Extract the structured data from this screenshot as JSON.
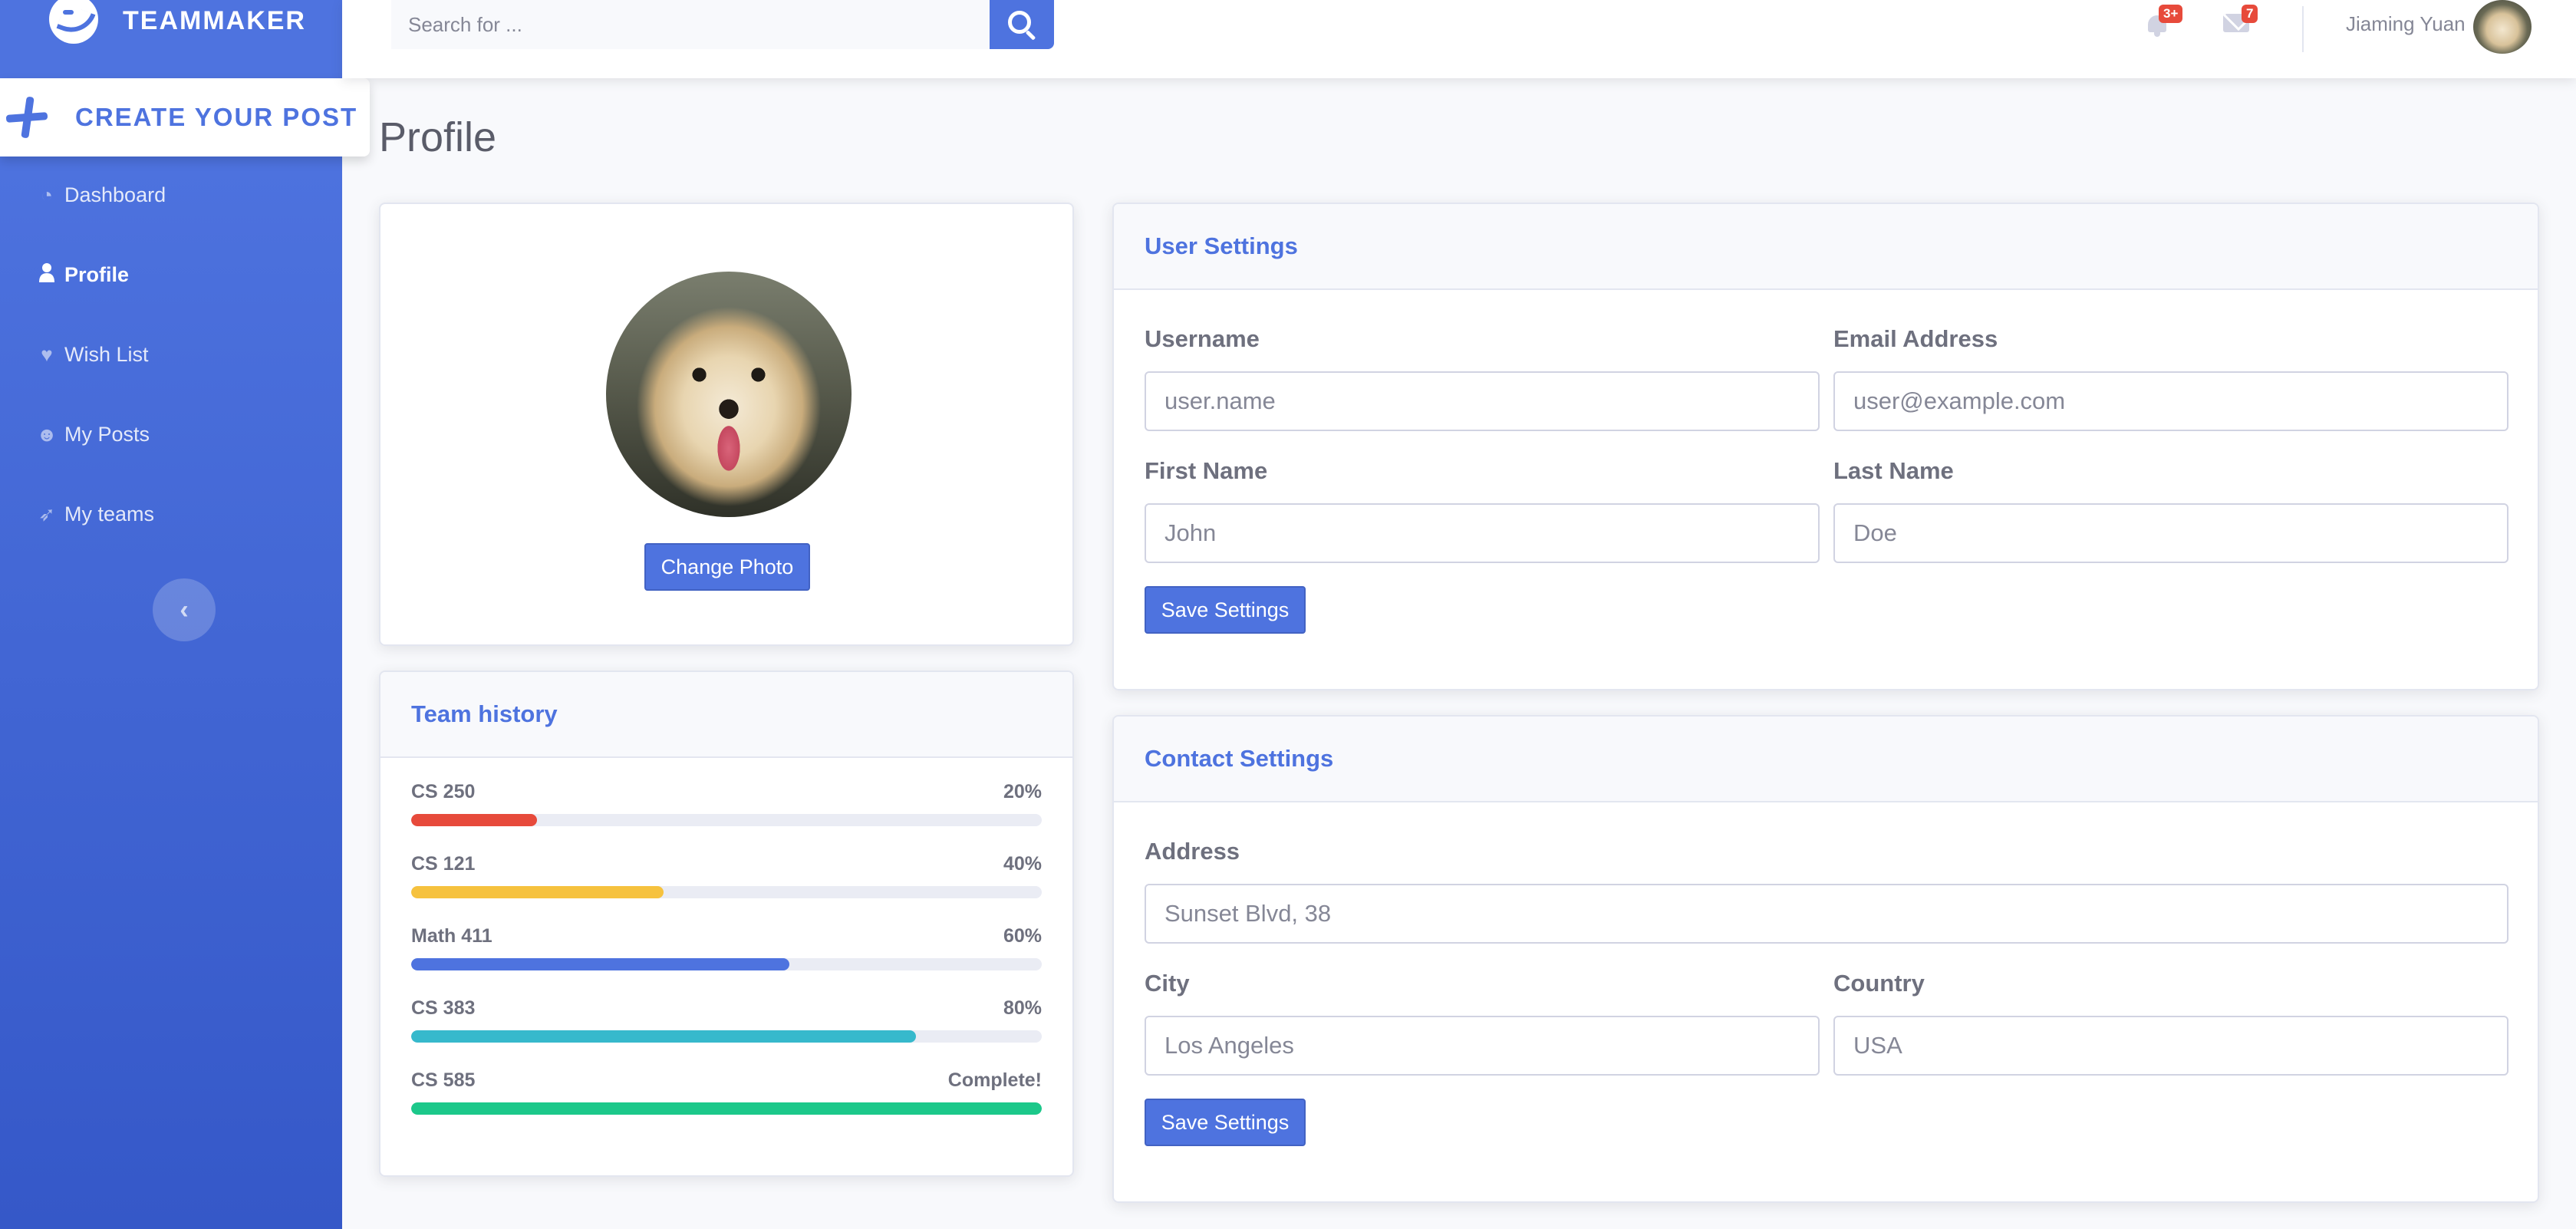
{
  "brand": {
    "name": "TEAMMAKER"
  },
  "sidebar": {
    "create_post": "CREATE YOUR POST",
    "items": [
      {
        "label": "Dashboard",
        "icon": "tachometer-icon",
        "glyph": "◔",
        "active": false
      },
      {
        "label": "Profile",
        "icon": "user-icon",
        "glyph": "👤",
        "active": true
      },
      {
        "label": "Wish List",
        "icon": "heart-icon",
        "glyph": "♥",
        "active": false
      },
      {
        "label": "My Posts",
        "icon": "user-circle-icon",
        "glyph": "☻",
        "active": false
      },
      {
        "label": "My teams",
        "icon": "rocket-icon",
        "glyph": "➶",
        "active": false
      }
    ],
    "toggle_glyph": "‹"
  },
  "topbar": {
    "search_placeholder": "Search for ...",
    "alerts_count": "3+",
    "messages_count": "7",
    "user_name": "Jiaming Yuan"
  },
  "page": {
    "title": "Profile"
  },
  "photo_card": {
    "button_label": "Change Photo"
  },
  "team_history": {
    "title": "Team history",
    "items": [
      {
        "name": "CS 250",
        "value_label": "20%",
        "progress": 0.2,
        "color": "#e74a3b"
      },
      {
        "name": "CS 121",
        "value_label": "40%",
        "progress": 0.4,
        "color": "#f6c23e"
      },
      {
        "name": "Math 411",
        "value_label": "60%",
        "progress": 0.6,
        "color": "#4e73df"
      },
      {
        "name": "CS 383",
        "value_label": "80%",
        "progress": 0.8,
        "color": "#36b9cc"
      },
      {
        "name": "CS 585",
        "value_label": "Complete!",
        "progress": 1.0,
        "color": "#1cc88a"
      }
    ]
  },
  "user_settings": {
    "title": "User Settings",
    "username_label": "Username",
    "username_placeholder": "user.name",
    "email_label": "Email Address",
    "email_placeholder": "user@example.com",
    "first_name_label": "First Name",
    "first_name_placeholder": "John",
    "last_name_label": "Last Name",
    "last_name_placeholder": "Doe",
    "save_label": "Save Settings"
  },
  "contact_settings": {
    "title": "Contact Settings",
    "address_label": "Address",
    "address_placeholder": "Sunset Blvd, 38",
    "city_label": "City",
    "city_placeholder": "Los Angeles",
    "country_label": "Country",
    "country_placeholder": "USA",
    "save_label": "Save Settings"
  },
  "colors": {
    "primary": "#4e73df",
    "danger": "#e74a3b",
    "warning": "#f6c23e",
    "info": "#36b9cc",
    "success": "#1cc88a"
  }
}
